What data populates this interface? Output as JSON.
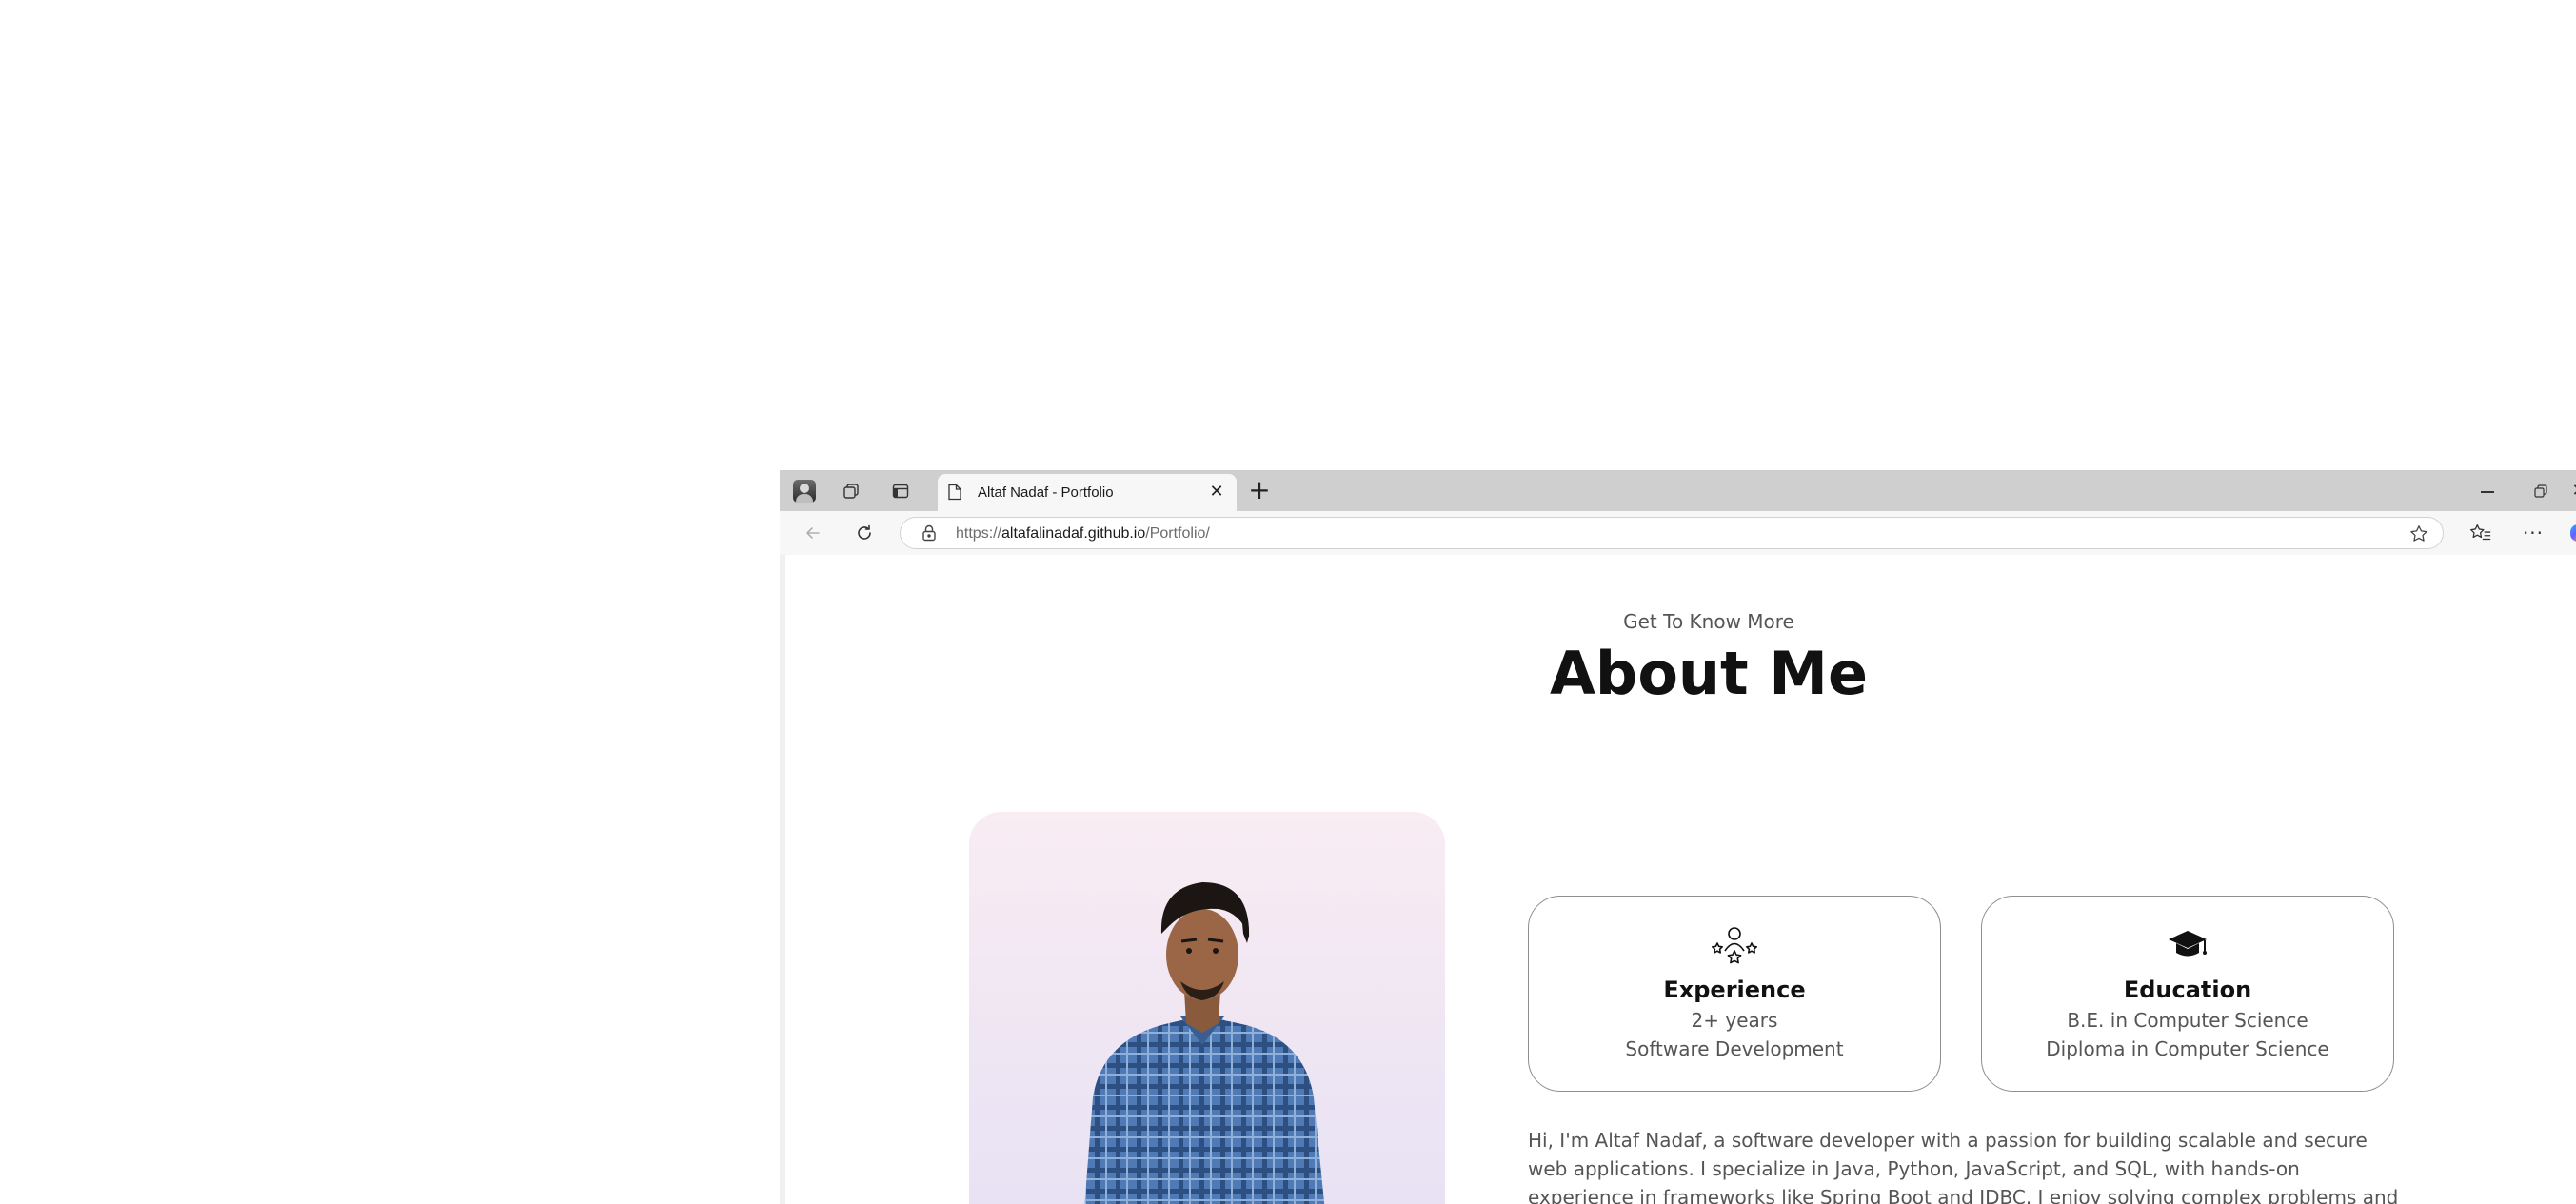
{
  "browser": {
    "tab": {
      "title": "Altaf Nadaf - Portfolio",
      "close_glyph": "✕"
    },
    "new_tab_glyph": "+",
    "window_controls": {
      "close_glyph": "✕"
    },
    "toolbar": {
      "more_glyph": "···"
    },
    "address": {
      "scheme": "https://",
      "host": "altafalinadaf.github.io",
      "path": "/Portfolio/"
    }
  },
  "page": {
    "section_subtitle": "Get To Know More",
    "section_title": "About Me",
    "cards": [
      {
        "title": "Experience",
        "line1": "2+ years",
        "line2": "Software Development",
        "icon": "stars-person-icon"
      },
      {
        "title": "Education",
        "line1": "B.E. in Computer Science",
        "line2": "Diploma in Computer Science",
        "icon": "graduation-cap-icon"
      }
    ],
    "bio": "Hi, I'm Altaf Nadaf, a software developer with a passion for building scalable and secure web applications. I specialize in Java, Python, JavaScript, and SQL, with hands-on experience in frameworks like Spring Boot and JDBC. I enjoy solving complex problems and"
  }
}
